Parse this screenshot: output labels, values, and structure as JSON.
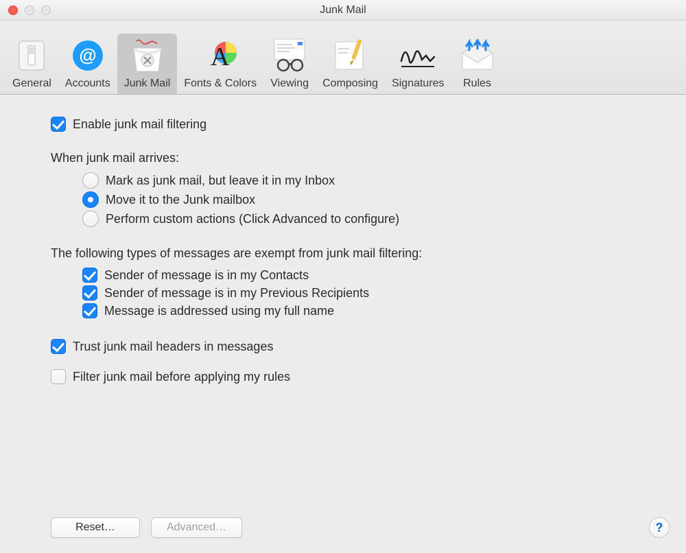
{
  "window": {
    "title": "Junk Mail"
  },
  "toolbar": {
    "items": [
      {
        "id": "general",
        "label": "General"
      },
      {
        "id": "accounts",
        "label": "Accounts"
      },
      {
        "id": "junkmail",
        "label": "Junk Mail"
      },
      {
        "id": "fontscolors",
        "label": "Fonts & Colors"
      },
      {
        "id": "viewing",
        "label": "Viewing"
      },
      {
        "id": "composing",
        "label": "Composing"
      },
      {
        "id": "signatures",
        "label": "Signatures"
      },
      {
        "id": "rules",
        "label": "Rules"
      }
    ],
    "active_id": "junkmail"
  },
  "content": {
    "enable_label": "Enable junk mail filtering",
    "enable_checked": true,
    "arrives_heading": "When junk mail arrives:",
    "arrives_options": [
      {
        "id": "mark",
        "label": "Mark as junk mail, but leave it in my Inbox",
        "selected": false
      },
      {
        "id": "move",
        "label": "Move it to the Junk mailbox",
        "selected": true
      },
      {
        "id": "custom",
        "label": "Perform custom actions (Click Advanced to configure)",
        "selected": false
      }
    ],
    "exempt_heading": "The following types of messages are exempt from junk mail filtering:",
    "exempt_items": [
      {
        "id": "contacts",
        "label": "Sender of message is in my Contacts",
        "checked": true
      },
      {
        "id": "previous",
        "label": "Sender of message is in my Previous Recipients",
        "checked": true
      },
      {
        "id": "fullname",
        "label": "Message is addressed using my full name",
        "checked": true
      }
    ],
    "trust_headers": {
      "label": "Trust junk mail headers in messages",
      "checked": true
    },
    "filter_before_rules": {
      "label": "Filter junk mail before applying my rules",
      "checked": false
    }
  },
  "buttons": {
    "reset": "Reset…",
    "advanced": "Advanced…",
    "help": "?"
  }
}
